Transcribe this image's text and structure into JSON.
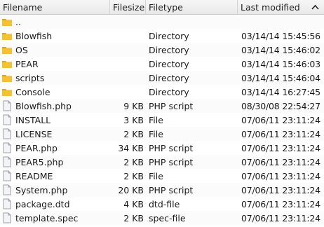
{
  "columns": {
    "filename": "Filename",
    "filesize": "Filesize",
    "filetype": "Filetype",
    "modified": "Last modified"
  },
  "rows": [
    {
      "name": "..",
      "size": "",
      "type": "",
      "modified": "",
      "icon": "folder-icon"
    },
    {
      "name": "Blowfish",
      "size": "",
      "type": "Directory",
      "modified": "03/14/14 15:45:56",
      "icon": "folder-icon"
    },
    {
      "name": "OS",
      "size": "",
      "type": "Directory",
      "modified": "03/14/14 15:46:02",
      "icon": "folder-icon"
    },
    {
      "name": "PEAR",
      "size": "",
      "type": "Directory",
      "modified": "03/14/14 15:46:03",
      "icon": "folder-icon"
    },
    {
      "name": "scripts",
      "size": "",
      "type": "Directory",
      "modified": "03/14/14 15:46:04",
      "icon": "folder-icon"
    },
    {
      "name": "Console",
      "size": "",
      "type": "Directory",
      "modified": "03/14/14 16:27:45",
      "icon": "folder-icon"
    },
    {
      "name": "Blowfish.php",
      "size": "9 KB",
      "type": "PHP script",
      "modified": "08/30/08 22:54:27",
      "icon": "file-icon"
    },
    {
      "name": "INSTALL",
      "size": "3 KB",
      "type": "File",
      "modified": "07/06/11 23:11:24",
      "icon": "file-icon"
    },
    {
      "name": "LICENSE",
      "size": "2 KB",
      "type": "File",
      "modified": "07/06/11 23:11:24",
      "icon": "file-icon"
    },
    {
      "name": "PEAR.php",
      "size": "34 KB",
      "type": "PHP script",
      "modified": "07/06/11 23:11:24",
      "icon": "file-icon"
    },
    {
      "name": "PEAR5.php",
      "size": "2 KB",
      "type": "PHP script",
      "modified": "07/06/11 23:11:24",
      "icon": "file-icon"
    },
    {
      "name": "README",
      "size": "2 KB",
      "type": "File",
      "modified": "07/06/11 23:11:24",
      "icon": "file-icon"
    },
    {
      "name": "System.php",
      "size": "20 KB",
      "type": "PHP script",
      "modified": "07/06/11 23:11:24",
      "icon": "file-icon"
    },
    {
      "name": "package.dtd",
      "size": "4 KB",
      "type": "dtd-file",
      "modified": "07/06/11 23:11:24",
      "icon": "file-icon"
    },
    {
      "name": "template.spec",
      "size": "2 KB",
      "type": "spec-file",
      "modified": "07/06/11 23:11:24",
      "icon": "file-icon"
    }
  ],
  "colors": {
    "folder": "#f2c230",
    "folder_dark": "#d9a514",
    "file": "#f4f4f6",
    "file_border": "#9aa0aa"
  }
}
